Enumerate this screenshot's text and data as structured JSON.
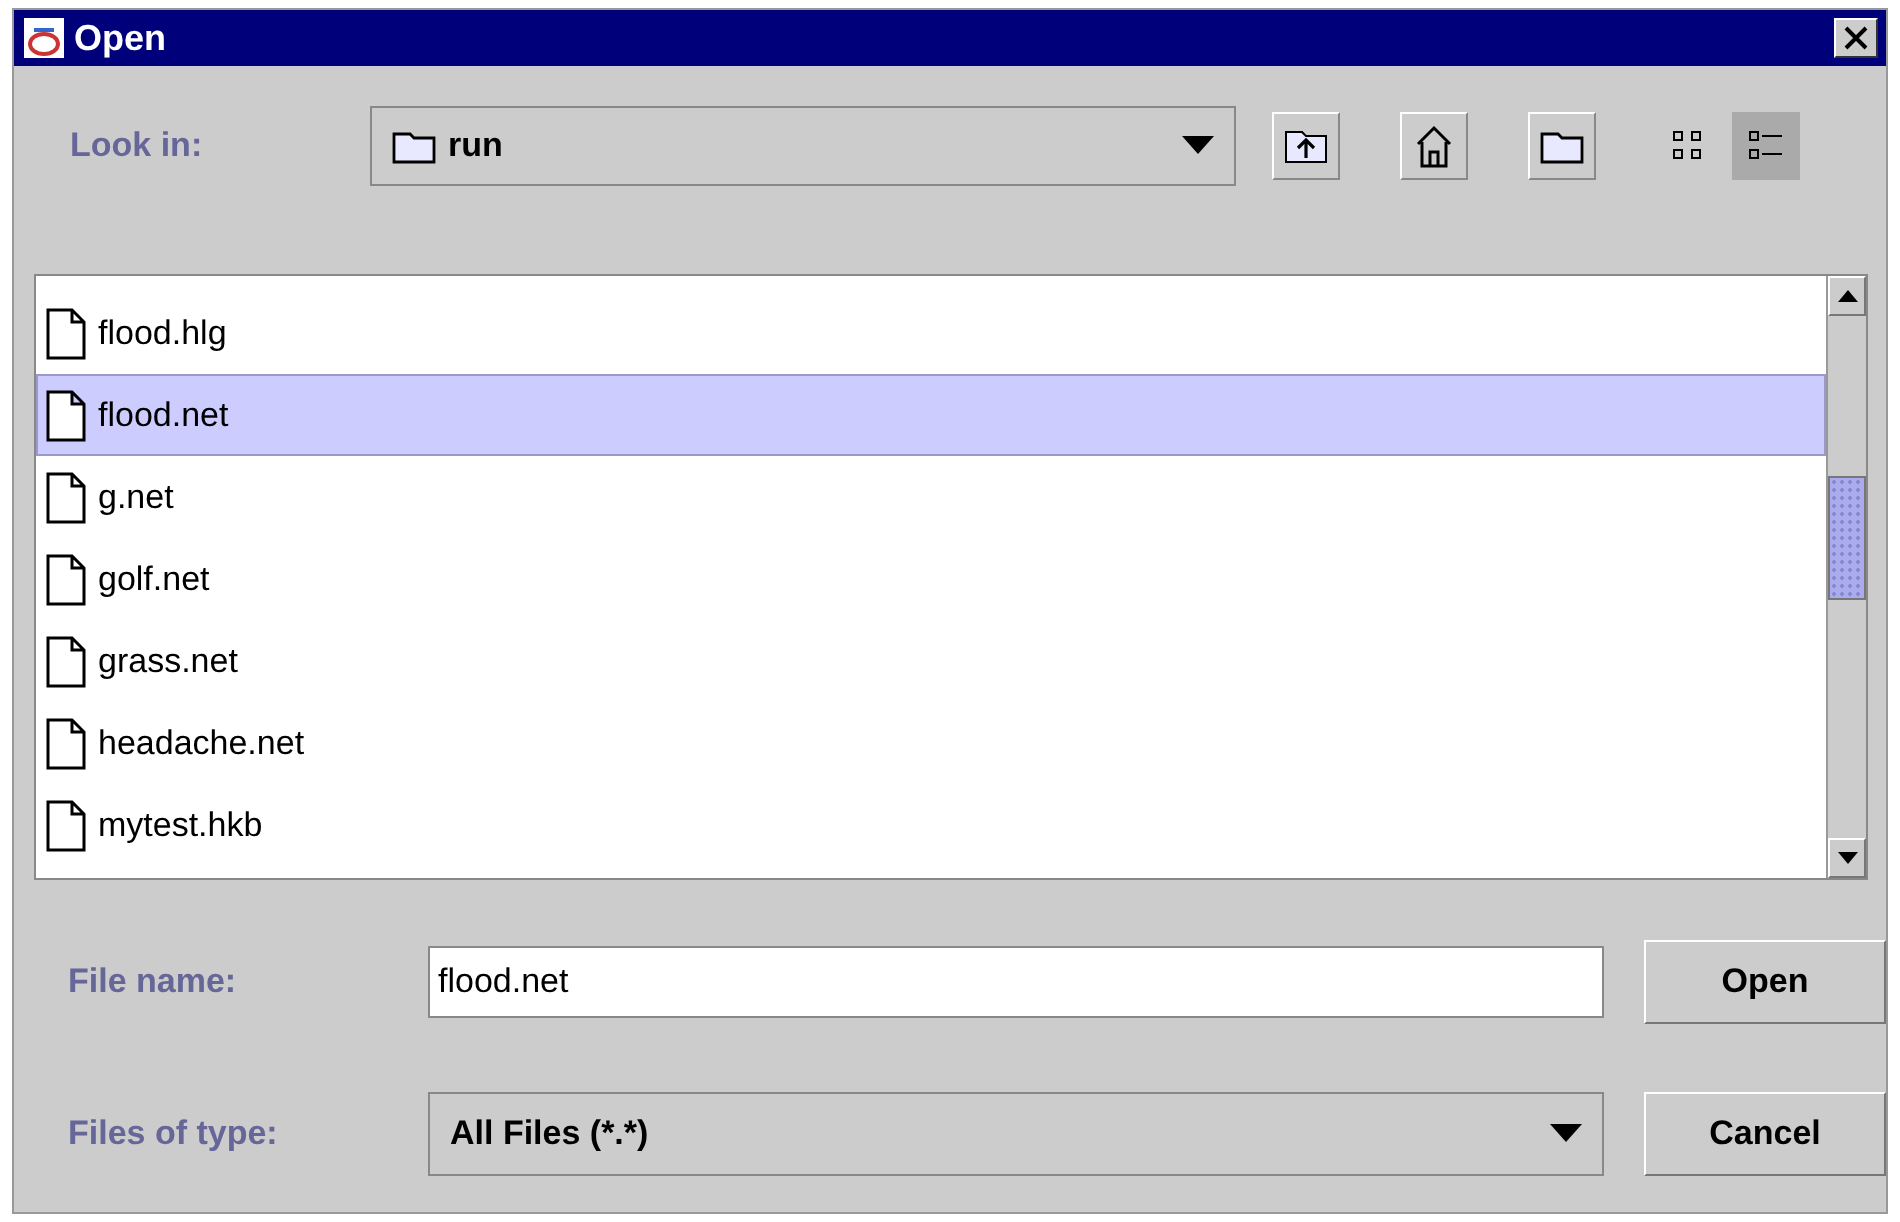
{
  "window": {
    "title": "Open"
  },
  "look_in": {
    "label": "Look in:",
    "value": "run"
  },
  "view_modes": [
    {
      "kind": "list",
      "selected": false
    },
    {
      "kind": "details",
      "selected": true
    }
  ],
  "files": [
    {
      "name": "flood.hlg",
      "selected": false
    },
    {
      "name": "flood.net",
      "selected": true
    },
    {
      "name": "g.net",
      "selected": false
    },
    {
      "name": "golf.net",
      "selected": false
    },
    {
      "name": "grass.net",
      "selected": false
    },
    {
      "name": "headache.net",
      "selected": false
    },
    {
      "name": "mytest.hkb",
      "selected": false
    }
  ],
  "file_name": {
    "label": "File name:",
    "value": "flood.net"
  },
  "file_type": {
    "label": "Files of type:",
    "value": "All Files (*.*)"
  },
  "buttons": [
    "Open",
    "Cancel"
  ]
}
